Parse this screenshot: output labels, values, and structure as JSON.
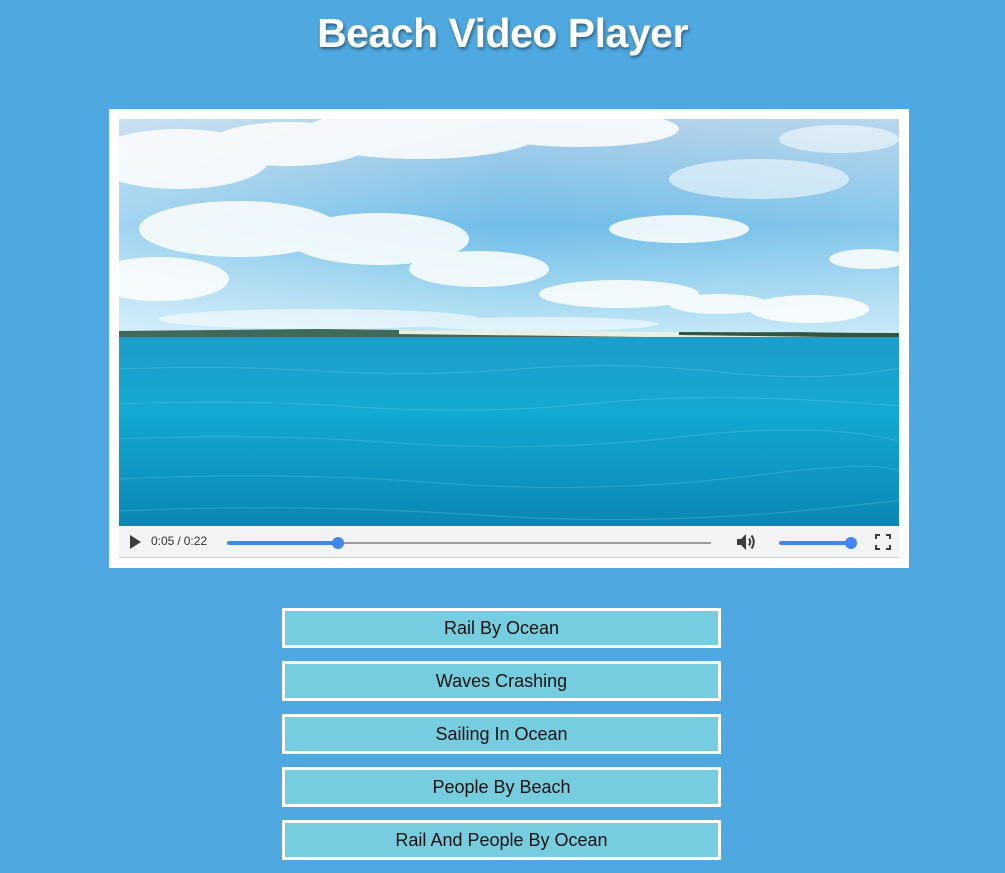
{
  "page": {
    "title": "Beach Video Player"
  },
  "player": {
    "current_time": "0:05",
    "duration": "0:22",
    "time_separator": "/",
    "progress": 0.23,
    "volume": 1.0,
    "accent_color": "#4285f4",
    "icons": {
      "play": "play-icon",
      "volume": "volume-icon",
      "fullscreen": "fullscreen-icon"
    }
  },
  "playlist": {
    "items": [
      {
        "label": "Rail By Ocean"
      },
      {
        "label": "Waves Crashing"
      },
      {
        "label": "Sailing In Ocean"
      },
      {
        "label": "People By Beach"
      },
      {
        "label": "Rail And People By Ocean"
      }
    ]
  },
  "colors": {
    "background": "#4fa8df",
    "button_fill": "#76cddf",
    "button_border": "#ffffff"
  }
}
